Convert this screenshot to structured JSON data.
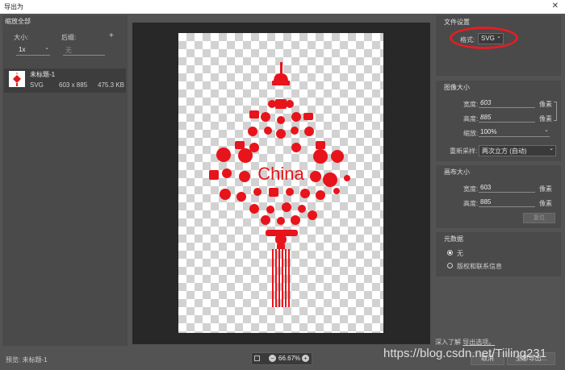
{
  "window": {
    "title": "导出为",
    "close_glyph": "✕"
  },
  "left": {
    "section_title": "缩放全部",
    "size_label": "大小:",
    "suffix_label": "后缀:",
    "add_glyph": "+",
    "scale_value": "1x",
    "suffix_placeholder": "无",
    "file": {
      "name": "未标题-1",
      "format": "SVG",
      "dimensions": "603 x 885",
      "filesize": "475.3 KB"
    }
  },
  "bottom": {
    "preview_text": "预览: 未标题-1",
    "zoom": "66.67%",
    "minus_glyph": "−",
    "plus_glyph": "+",
    "link_prefix": "深入了解",
    "link_text": "导出选项。",
    "watermark": "https://blog.csdn.net/Tiiling231",
    "cancel_label": "取消",
    "export_label": "全部导出..."
  },
  "file_settings": {
    "title": "文件设置",
    "format_label": "格式:",
    "format_value": "SVG"
  },
  "image_size": {
    "title": "图像大小",
    "width_label": "宽度:",
    "width_value": "603",
    "height_label": "高度:",
    "height_value": "885",
    "scale_label": "缩放:",
    "scale_value": "100%",
    "resample_label": "重新采样:",
    "resample_value": "两次立方 (自动)",
    "unit": "像素"
  },
  "canvas_size": {
    "title": "画布大小",
    "width_label": "宽度:",
    "width_value": "603",
    "height_label": "高度:",
    "height_value": "885",
    "unit": "像素",
    "reset_label": "复位"
  },
  "metadata": {
    "title": "元数据",
    "option_none": "无",
    "option_copyright": "版权和联系信息"
  },
  "artwork": {
    "label": "China",
    "color": "#e8141b"
  }
}
